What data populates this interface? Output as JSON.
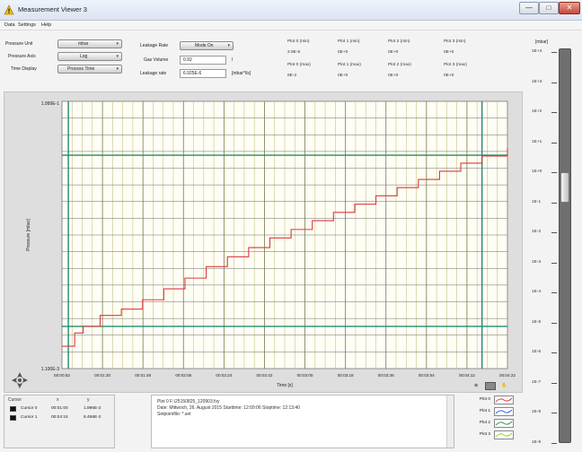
{
  "window": {
    "title": "Measurement Viewer 3",
    "controls": {
      "minimize": "—",
      "maximize": "□",
      "close": "✕"
    }
  },
  "menu": [
    "Data",
    "Settings",
    "Help"
  ],
  "settings": {
    "pressure_unit_label": "Pressure Unit",
    "pressure_unit_value": "mbar",
    "pressure_axis_label": "Pressure Axis",
    "pressure_axis_value": "Log",
    "time_display_label": "Time Display",
    "time_display_value": "Process Time",
    "leakage_rate_mode_label": "Leakage Rate",
    "leakage_rate_mode_value": "Mode On",
    "gas_volume_label": "Gas Volume",
    "gas_volume_value": "0.92",
    "gas_volume_unit": "l",
    "leakage_rate_label": "Leakage rate",
    "leakage_rate_value": "6.925E-6",
    "leakage_rate_unit": "[mbar*l/s]"
  },
  "plot_stats": {
    "headers_min": [
      "Plot 0 (min)",
      "Plot 1 (min)",
      "Plot 2 (min)",
      "Plot 3 (min)"
    ],
    "values_min": [
      "2.9E-5",
      "0E+0",
      "0E+0",
      "0E+0"
    ],
    "headers_max": [
      "Plot 0 (max)",
      "Plot 1 (max)",
      "Plot 2 (max)",
      "Plot 3 (max)"
    ],
    "values_max": [
      "8E-2",
      "0E+0",
      "0E+0",
      "0E+0"
    ]
  },
  "chart_data": {
    "type": "line",
    "title": "",
    "xlabel": "Time [s]",
    "ylabel": "Pressure [mbar]",
    "y_top_label": "1.999E-1",
    "y_bottom_label": "1.100E-3",
    "x_tick_labels": [
      "00:00:52",
      "00:01:30",
      "00:01:48",
      "00:02:06",
      "00:02:24",
      "00:02:42",
      "00:03:00",
      "00:03:18",
      "00:03:36",
      "00:03:54",
      "00:04:12",
      "00:04:22"
    ],
    "grid": true,
    "yscale": "log",
    "series": [
      {
        "color": "#d83a3a",
        "x_s": [
          52,
          55,
          58,
          62,
          70,
          80,
          90,
          100,
          110,
          120,
          130,
          140,
          150,
          160,
          170,
          180,
          190,
          200,
          210,
          220,
          230,
          240,
          250,
          262
        ],
        "y_mbar": [
          0.0017,
          0.0017,
          0.0022,
          0.0025,
          0.0031,
          0.0035,
          0.0042,
          0.0052,
          0.0064,
          0.008,
          0.0097,
          0.0116,
          0.014,
          0.0165,
          0.0196,
          0.023,
          0.027,
          0.0318,
          0.0373,
          0.0437,
          0.0513,
          0.06,
          0.069,
          0.08
        ]
      }
    ],
    "cursor_lines": {
      "color": "#1f8a70",
      "x_s": [
        55,
        250
      ],
      "y_mbar": [
        0.0025,
        0.07
      ]
    }
  },
  "right_scale": {
    "unit": "[mbar]",
    "labels": [
      "1E+4",
      "1E+3",
      "1E+2",
      "1E+1",
      "1E+0",
      "1E-1",
      "1E-2",
      "1E-3",
      "1E-4",
      "1E-5",
      "1E-6",
      "1E-7",
      "1E-8",
      "1E-9"
    ],
    "thumb_level_fraction": 0.34
  },
  "cursor_table": {
    "headers": [
      "Cursor",
      "x",
      "y"
    ],
    "rows": [
      {
        "name": "Cursor 0",
        "x": "00:01:00",
        "y": "1.896E-2"
      },
      {
        "name": "Cursor 1",
        "x": "00:04:16",
        "y": "8.466E-2"
      }
    ]
  },
  "info": {
    "lines": [
      "Plot 0 F:\\25150825_120903.fvy",
      "Date: Mittwoch, 26. August 2015 Starttime: 12:09:06 Stoptime: 12:13:40",
      "Setpointfile: *.set"
    ]
  },
  "legend": {
    "items": [
      {
        "label": "Plot 0",
        "color": "#d83a3a"
      },
      {
        "label": "Plot 1",
        "color": "#3a5ad8"
      },
      {
        "label": "Plot 2",
        "color": "#3a8a5a"
      },
      {
        "label": "Plot 3",
        "color": "#9acd32"
      }
    ]
  }
}
